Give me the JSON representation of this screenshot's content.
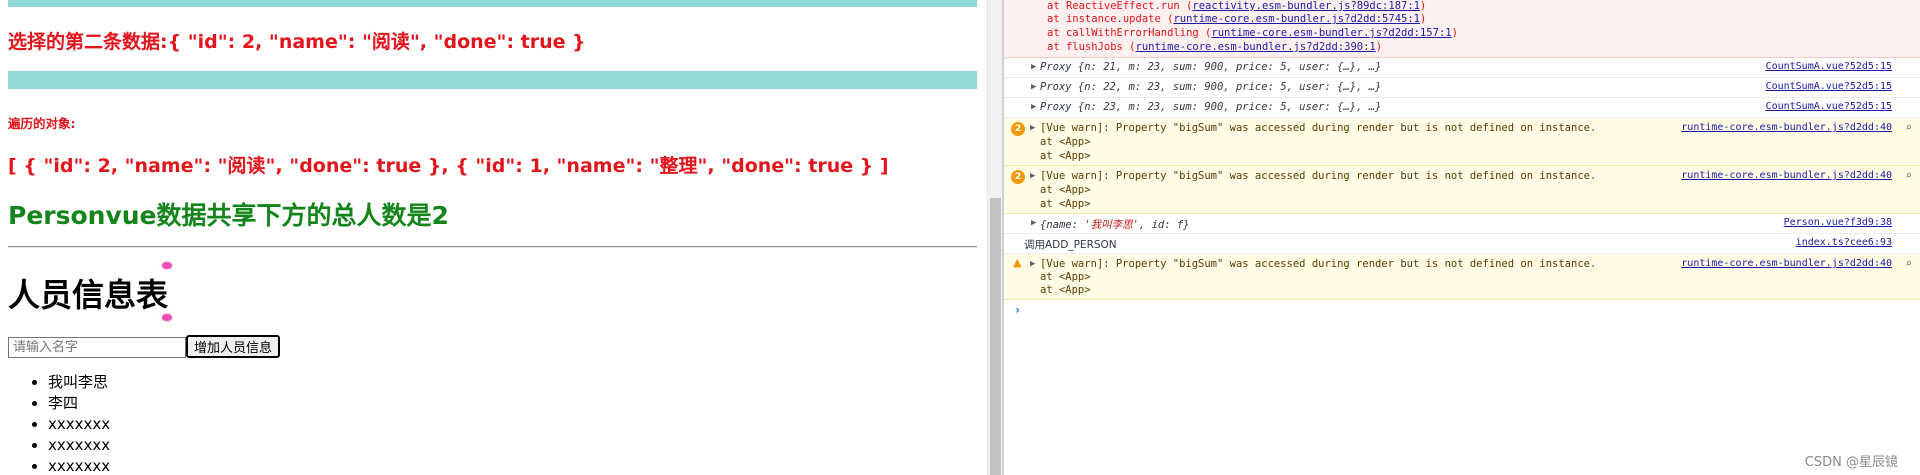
{
  "app": {
    "selected_text": "选择的第二条数据:{ \"id\": 2, \"name\": \"阅读\", \"done\": true }",
    "traverse_label": "遍历的对象:",
    "array_text": "[ { \"id\": 2, \"name\": \"阅读\", \"done\": true }, { \"id\": 1, \"name\": \"整理\", \"done\": true } ]",
    "count_text": "Personvue数据共享下方的总人数是2",
    "person_title": "人员信息表",
    "name_input": {
      "placeholder": "请输入名字",
      "value": ""
    },
    "add_button_label": "增加人员信息",
    "persons": [
      "我叫李思",
      "李四",
      "xxxxxxx",
      "xxxxxxx",
      "xxxxxxx"
    ]
  },
  "console": {
    "error_stack": [
      {
        "prefix": "at ReactiveEffect.run (",
        "link": "reactivity.esm-bundler.js?89dc:187:1",
        "suffix": ")"
      },
      {
        "prefix": "at instance.update (",
        "link": "runtime-core.esm-bundler.js?d2dd:5745:1",
        "suffix": ")"
      },
      {
        "prefix": "at callWithErrorHandling (",
        "link": "runtime-core.esm-bundler.js?d2dd:157:1",
        "suffix": ")"
      },
      {
        "prefix": "at flushJobs (",
        "link": "runtime-core.esm-bundler.js?d2dd:390:1",
        "suffix": ")"
      }
    ],
    "proxy_rows": [
      {
        "text": "Proxy {n: 21, m: 23, sum: 900, price: 5, user: {…}, …}",
        "source": "CountSumA.vue?52d5:15"
      },
      {
        "text": "Proxy {n: 22, m: 23, sum: 900, price: 5, user: {…}, …}",
        "source": "CountSumA.vue?52d5:15"
      },
      {
        "text": "Proxy {n: 23, m: 23, sum: 900, price: 5, user: {…}, …}",
        "source": "CountSumA.vue?52d5:15"
      }
    ],
    "warnings": [
      {
        "count": "2",
        "message": "[Vue warn]: Property \"bigSum\" was accessed during render but is not defined on instance.",
        "lines": [
          "at <App>",
          "at <App>"
        ],
        "source": "runtime-core.esm-bundler.js?d2dd:40"
      },
      {
        "count": "2",
        "message": "[Vue warn]: Property \"bigSum\" was accessed during render but is not defined on instance.",
        "lines": [
          "at <App>",
          "at <App>"
        ],
        "source": "runtime-core.esm-bundler.js?d2dd:40"
      }
    ],
    "obj_row": {
      "prefix": "{name: ",
      "value": "'我叫李思'",
      "suffix": ", id: f}",
      "source": "Person.vue?f3d9:38"
    },
    "log_row": {
      "text": "调用ADD_PERSON",
      "source": "index.ts?cee6:93"
    },
    "last_warning": {
      "message": "[Vue warn]: Property \"bigSum\" was accessed during render but is not defined on instance.",
      "lines": [
        "at <App>",
        "at <App>"
      ],
      "source": "runtime-core.esm-bundler.js?d2dd:40"
    },
    "prompt": "›"
  },
  "watermark": "CSDN @星辰镜"
}
